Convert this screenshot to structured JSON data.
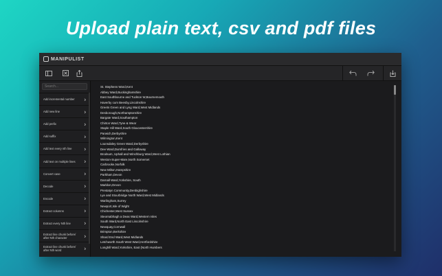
{
  "headline": "Upload plain text, csv and pdf files",
  "app": {
    "title": "MANIPULIST"
  },
  "toolbar": {
    "left_icons": [
      "sidebar-toggle-icon",
      "clear-icon",
      "share-icon"
    ],
    "right_icons": [
      "undo-icon",
      "redo-icon",
      "download-icon"
    ]
  },
  "sidebar": {
    "search_placeholder": "Search...",
    "items": [
      {
        "label": "Add incremental number"
      },
      {
        "label": "Add new line"
      },
      {
        "label": "Add prefix"
      },
      {
        "label": "Add suffix"
      },
      {
        "label": "Add text every nth line"
      },
      {
        "label": "Add text on multiple lines"
      },
      {
        "label": "Convert case"
      },
      {
        "label": "Decode"
      },
      {
        "label": "Encode"
      },
      {
        "label": "Extract columns"
      },
      {
        "label": "Extract every Nth line"
      },
      {
        "label": "Extract line chunk before/ after Nth character"
      },
      {
        "label": "Extract line chunk before/ after Nth word"
      }
    ]
  },
  "content": {
    "lines": [
      "St. Stephens Ward,Kent",
      "Abbey Ward,Buckinghamshire",
      "East Southbourne and Tuckton W,Bournemouth",
      "Haverby cum Beesby,Lincolnshire",
      "Greets Green and Lyng Ward,West Midlands",
      "Desborough,Northamptonshire",
      "Bargate Ward,Southampton",
      "Chirton Ward,Tyne & Wear",
      "Staple Hill Ward,South Gloucestershire",
      "Parwich,Derbyshire",
      "Wilmington,Kent",
      "Lounsdaley Green Ward,Derbyshire",
      "Dee Ward,Dumfries and Galloway",
      "Brodsum, Uphall and Winchburg Ward,West Lothian",
      "Weston-Super-Mare,North Somerset",
      "Carbrooke,Norfolk",
      "New Milton,Hampshire",
      "Parkham,Devon",
      "Darnall Ward,Yorkshire, South",
      "Marldon,Devon",
      "Prestatyn Community,Denbighshire",
      "Lye and Stourbridge North Ward,West Midlands",
      "Warlingham,Surrey",
      "Newport,Isle of Wight",
      "Chichester,West Sussex",
      "Steornabhagh a Deas Ward,Western Isles",
      "South Ward,North East Lincolnshire",
      "Newquay,Cornwall",
      "Brimpton,Berkshire",
      "Shard End Ward,West Midlands",
      "Letchworth South West Ward,Hertfordshire",
      "Longhill Ward,Yorkshire, East (North Humbers"
    ]
  }
}
